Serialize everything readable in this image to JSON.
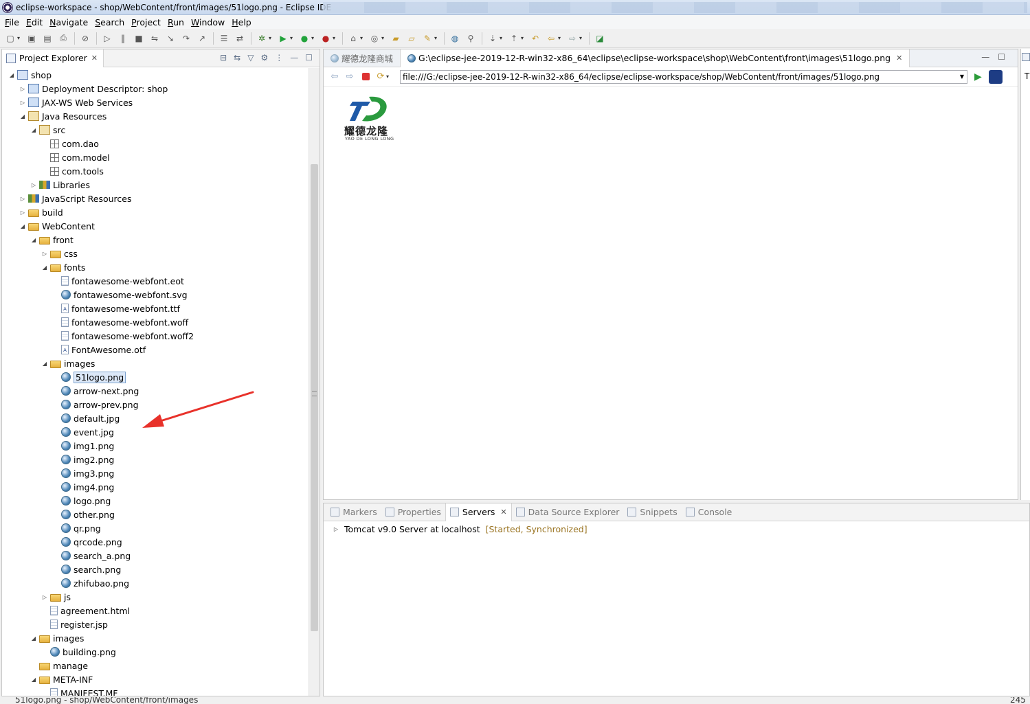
{
  "window": {
    "title": "eclipse-workspace - shop/WebContent/front/images/51logo.png - Eclipse IDE"
  },
  "menu": [
    "File",
    "Edit",
    "Navigate",
    "Search",
    "Project",
    "Run",
    "Window",
    "Help"
  ],
  "explorer": {
    "tab_label": "Project Explorer",
    "tree": [
      {
        "label": "shop",
        "depth": 0,
        "twisty": "open",
        "icon": "project"
      },
      {
        "label": "Deployment Descriptor: shop",
        "depth": 1,
        "twisty": "closed",
        "icon": "ws"
      },
      {
        "label": "JAX-WS Web Services",
        "depth": 1,
        "twisty": "closed",
        "icon": "ws"
      },
      {
        "label": "Java Resources",
        "depth": 1,
        "twisty": "open",
        "icon": "jar"
      },
      {
        "label": "src",
        "depth": 2,
        "twisty": "open",
        "icon": "jar"
      },
      {
        "label": "com.dao",
        "depth": 3,
        "twisty": "none",
        "icon": "package"
      },
      {
        "label": "com.model",
        "depth": 3,
        "twisty": "none",
        "icon": "package"
      },
      {
        "label": "com.tools",
        "depth": 3,
        "twisty": "none",
        "icon": "package"
      },
      {
        "label": "Libraries",
        "depth": 2,
        "twisty": "closed",
        "icon": "lib"
      },
      {
        "label": "JavaScript Resources",
        "depth": 1,
        "twisty": "closed",
        "icon": "lib"
      },
      {
        "label": "build",
        "depth": 1,
        "twisty": "closed",
        "icon": "folder"
      },
      {
        "label": "WebContent",
        "depth": 1,
        "twisty": "open",
        "icon": "folder"
      },
      {
        "label": "front",
        "depth": 2,
        "twisty": "open",
        "icon": "folder"
      },
      {
        "label": "css",
        "depth": 3,
        "twisty": "closed",
        "icon": "folder"
      },
      {
        "label": "fonts",
        "depth": 3,
        "twisty": "open",
        "icon": "folder"
      },
      {
        "label": "fontawesome-webfont.eot",
        "depth": 4,
        "twisty": "none",
        "icon": "file"
      },
      {
        "label": "fontawesome-webfont.svg",
        "depth": 4,
        "twisty": "none",
        "icon": "globe"
      },
      {
        "label": "fontawesome-webfont.ttf",
        "depth": 4,
        "twisty": "none",
        "icon": "fontfile"
      },
      {
        "label": "fontawesome-webfont.woff",
        "depth": 4,
        "twisty": "none",
        "icon": "file"
      },
      {
        "label": "fontawesome-webfont.woff2",
        "depth": 4,
        "twisty": "none",
        "icon": "file"
      },
      {
        "label": "FontAwesome.otf",
        "depth": 4,
        "twisty": "none",
        "icon": "fontfile"
      },
      {
        "label": "images",
        "depth": 3,
        "twisty": "open",
        "icon": "folder"
      },
      {
        "label": "51logo.png",
        "depth": 4,
        "twisty": "none",
        "icon": "globe",
        "selected": true
      },
      {
        "label": "arrow-next.png",
        "depth": 4,
        "twisty": "none",
        "icon": "globe"
      },
      {
        "label": "arrow-prev.png",
        "depth": 4,
        "twisty": "none",
        "icon": "globe"
      },
      {
        "label": "default.jpg",
        "depth": 4,
        "twisty": "none",
        "icon": "globe"
      },
      {
        "label": "event.jpg",
        "depth": 4,
        "twisty": "none",
        "icon": "globe"
      },
      {
        "label": "img1.png",
        "depth": 4,
        "twisty": "none",
        "icon": "globe"
      },
      {
        "label": "img2.png",
        "depth": 4,
        "twisty": "none",
        "icon": "globe"
      },
      {
        "label": "img3.png",
        "depth": 4,
        "twisty": "none",
        "icon": "globe"
      },
      {
        "label": "img4.png",
        "depth": 4,
        "twisty": "none",
        "icon": "globe"
      },
      {
        "label": "logo.png",
        "depth": 4,
        "twisty": "none",
        "icon": "globe"
      },
      {
        "label": "other.png",
        "depth": 4,
        "twisty": "none",
        "icon": "globe"
      },
      {
        "label": "qr.png",
        "depth": 4,
        "twisty": "none",
        "icon": "globe"
      },
      {
        "label": "qrcode.png",
        "depth": 4,
        "twisty": "none",
        "icon": "globe"
      },
      {
        "label": "search_a.png",
        "depth": 4,
        "twisty": "none",
        "icon": "globe"
      },
      {
        "label": "search.png",
        "depth": 4,
        "twisty": "none",
        "icon": "globe"
      },
      {
        "label": "zhifubao.png",
        "depth": 4,
        "twisty": "none",
        "icon": "globe"
      },
      {
        "label": "js",
        "depth": 3,
        "twisty": "closed",
        "icon": "folder"
      },
      {
        "label": "agreement.html",
        "depth": 3,
        "twisty": "none",
        "icon": "file"
      },
      {
        "label": "register.jsp",
        "depth": 3,
        "twisty": "none",
        "icon": "file"
      },
      {
        "label": "images",
        "depth": 2,
        "twisty": "open",
        "icon": "folder"
      },
      {
        "label": "building.png",
        "depth": 3,
        "twisty": "none",
        "icon": "globe"
      },
      {
        "label": "manage",
        "depth": 2,
        "twisty": "none",
        "icon": "folder"
      },
      {
        "label": "META-INF",
        "depth": 2,
        "twisty": "open",
        "icon": "folder"
      },
      {
        "label": "MANIFEST.MF",
        "depth": 3,
        "twisty": "none",
        "icon": "file"
      }
    ]
  },
  "editor": {
    "tabs": [
      {
        "label": "耀德龙隆商城",
        "active": false
      },
      {
        "label": "G:\\eclipse-jee-2019-12-R-win32-x86_64\\eclipse\\eclipse-workspace\\shop\\WebContent\\front\\images\\51logo.png",
        "active": true
      }
    ],
    "url": "file:///G:/eclipse-jee-2019-12-R-win32-x86_64/eclipse/eclipse-workspace/shop/WebContent/front/images/51logo.png",
    "logo": {
      "name_cn": "耀德龙隆",
      "name_en": "YAO DE LONG LONG",
      "color_green": "#2a9a3e",
      "color_blue": "#1f5aa8"
    }
  },
  "right_strip": {
    "label": "T"
  },
  "bottom": {
    "tabs": [
      "Markers",
      "Properties",
      "Servers",
      "Data Source Explorer",
      "Snippets",
      "Console"
    ],
    "active_tab": "Servers",
    "server": {
      "name": "Tomcat v9.0 Server at localhost",
      "state": "[Started, Synchronized]"
    }
  },
  "status": {
    "text": "51logo.png - shop/WebContent/front/images",
    "right": "245"
  },
  "colors": {
    "selection_bg": "#dce8f8",
    "annotation_arrow": "#e8312a"
  }
}
